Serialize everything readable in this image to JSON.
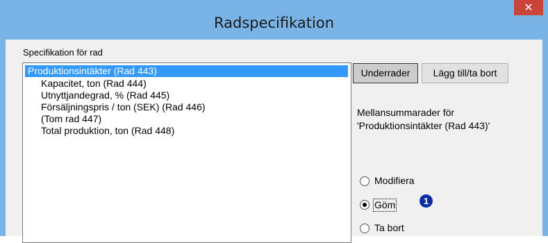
{
  "window": {
    "title": "Radspecifikation",
    "close_glyph": "✕"
  },
  "spec": {
    "label": "Specifikation för rad",
    "items": [
      "Produktionsintäkter (Rad 443)",
      "Kapacitet, ton (Rad 444)",
      "Utnyttjandegrad, % (Rad 445)",
      "Försäljningspris / ton (SEK) (Rad 446)",
      "(Tom rad 447)",
      "Total produktion, ton (Rad 448)"
    ],
    "selected_index": 0
  },
  "buttons": {
    "underrader": "Underrader",
    "lagg_till": "Lägg till/ta bort"
  },
  "info": {
    "line1": "Mellansummarader för",
    "line2": "'Produktionsintäkter (Rad 443)'"
  },
  "options": {
    "modify": "Modifiera",
    "hide": "Göm",
    "remove": "Ta bort",
    "selected": "hide"
  },
  "badge": "1",
  "colors": {
    "titlebar": "#7ab3e6",
    "close": "#c9453a",
    "selection": "#3399ff",
    "badge": "#0a2da6"
  }
}
